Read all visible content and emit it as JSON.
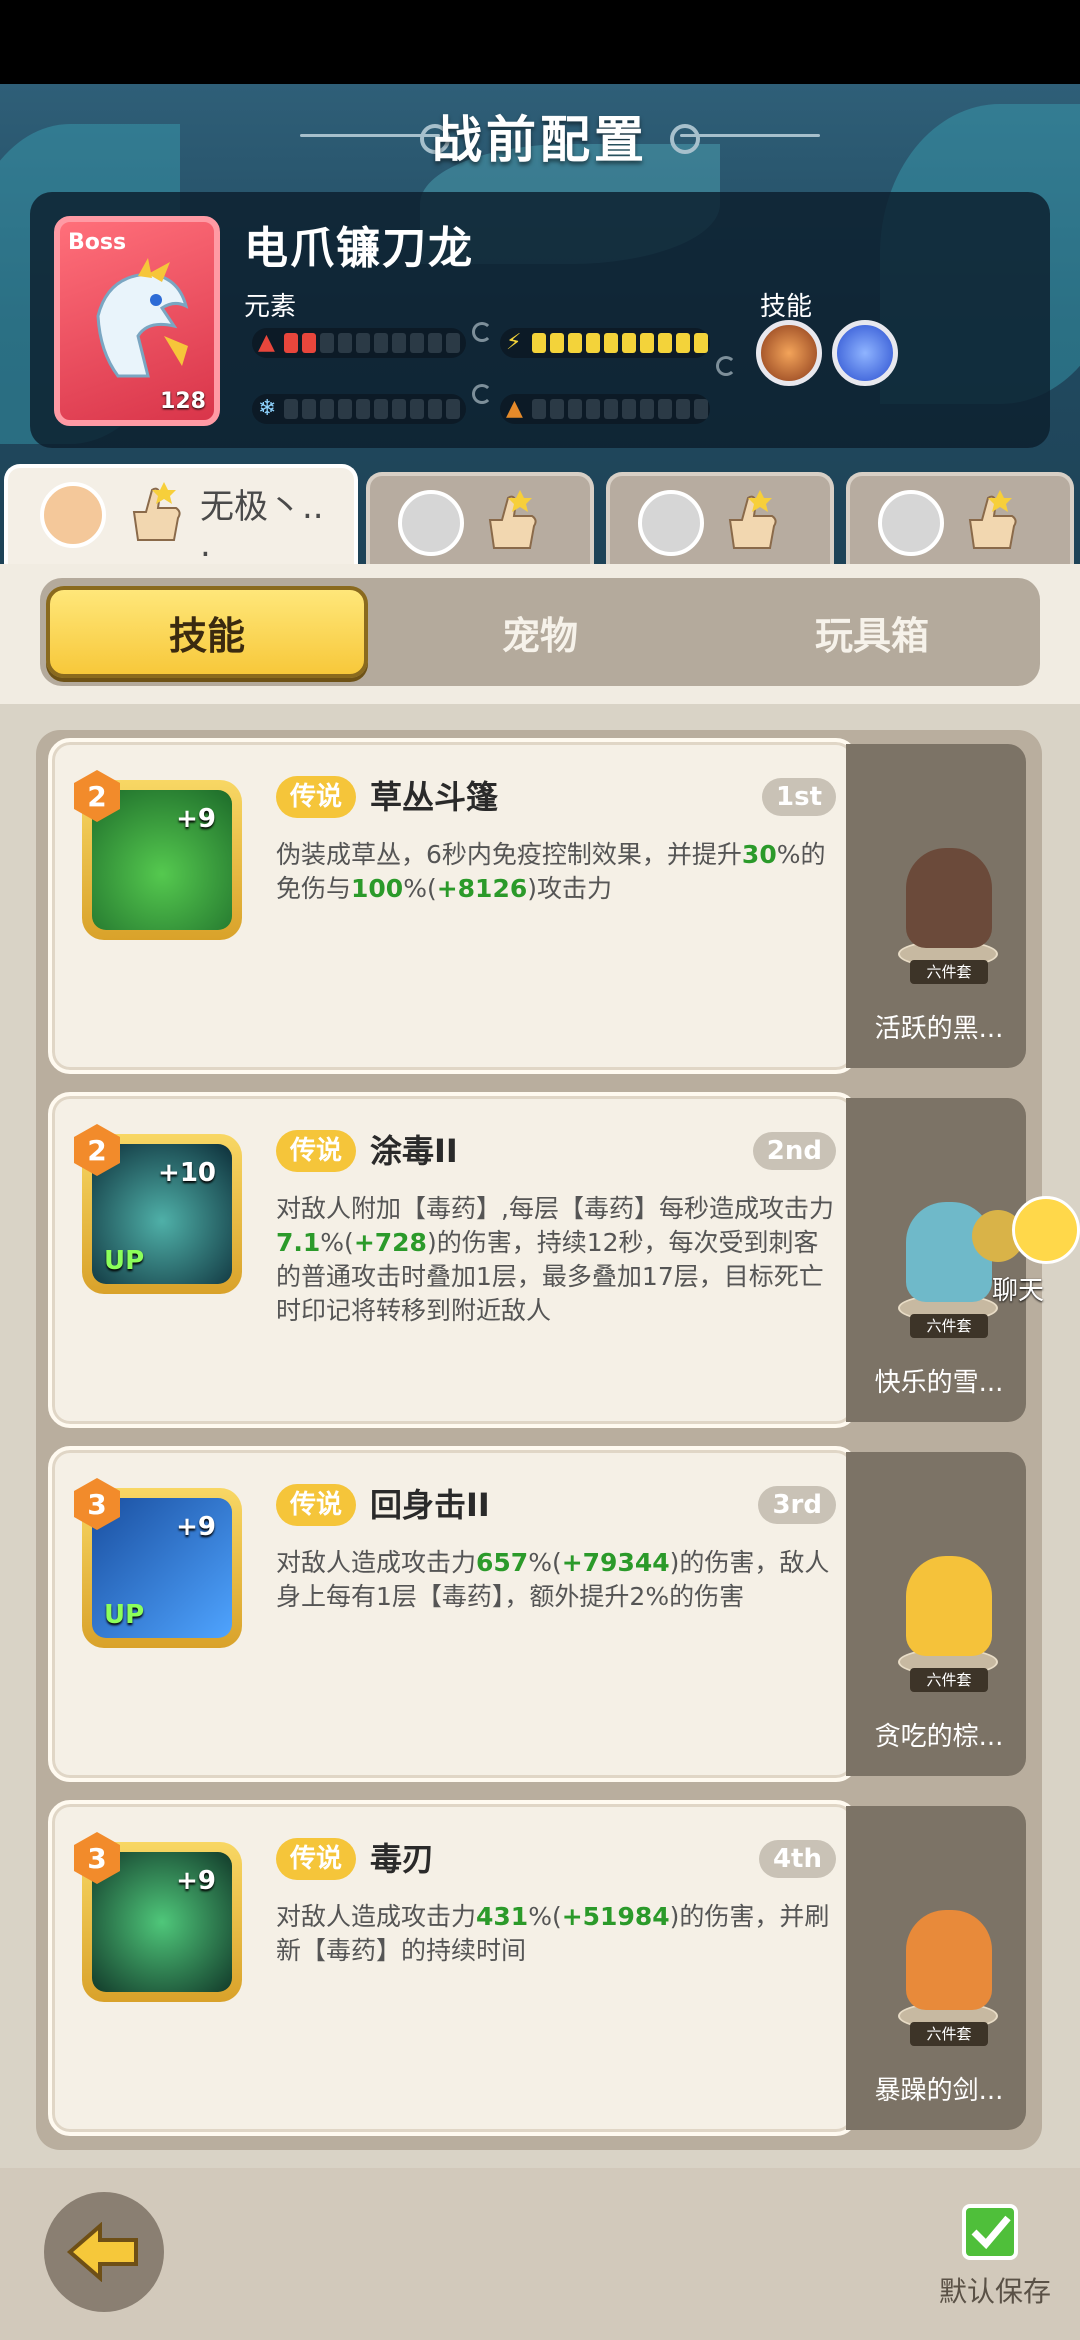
{
  "header": {
    "title": "战前配置"
  },
  "boss": {
    "tag": "Boss",
    "name": "电爪镰刀龙",
    "level": "128",
    "element_label": "元素",
    "skill_label": "技能",
    "elements": [
      {
        "icon": "fire-icon",
        "filled": 2,
        "color": "#e8463c"
      },
      {
        "icon": "lightning-icon",
        "filled": 10,
        "color": "#f3d33a"
      },
      {
        "icon": "ice-icon",
        "filled": 0,
        "color": "#8fd4ff"
      },
      {
        "icon": "earth-icon",
        "filled": 0,
        "color": "#e58a2a"
      }
    ],
    "skills": [
      "claw-skill-icon",
      "lightning-skill-icon"
    ]
  },
  "players": [
    {
      "name": "无极丶.. .",
      "active": true
    },
    {
      "name": "",
      "active": false
    },
    {
      "name": "",
      "active": false
    },
    {
      "name": "",
      "active": false
    }
  ],
  "tabs": [
    {
      "label": "技能",
      "active": true
    },
    {
      "label": "宠物",
      "active": false
    },
    {
      "label": "玩具箱",
      "active": false
    }
  ],
  "skills": [
    {
      "level": "2",
      "plus": "+9",
      "up": "",
      "rarity": "传说",
      "name": "草丛斗篷",
      "rank": "1st",
      "desc": [
        {
          "t": "伪装成草丛，6秒内免疫控制效果，并提升",
          "g": false
        },
        {
          "t": "30",
          "g": true
        },
        {
          "t": "%的免伤与",
          "g": false
        },
        {
          "t": "100",
          "g": true
        },
        {
          "t": "%(",
          "g": false
        },
        {
          "t": "+8126",
          "g": true
        },
        {
          "t": ")攻击力",
          "g": false
        }
      ],
      "pet": {
        "set": "六件套",
        "name": "活跃的黑..."
      }
    },
    {
      "level": "2",
      "plus": "+10",
      "up": "UP",
      "rarity": "传说",
      "name": "涂毒II",
      "rank": "2nd",
      "desc": [
        {
          "t": "对敌人附加【毒药】,每层【毒药】每秒造成攻击力",
          "g": false
        },
        {
          "t": "7.1",
          "g": true
        },
        {
          "t": "%(",
          "g": false
        },
        {
          "t": "+728",
          "g": true
        },
        {
          "t": ")的伤害，持续12秒，每次受到刺客的普通攻击时叠加1层，最多叠加17层，目标死亡时印记将转移到附近敌人",
          "g": false
        }
      ],
      "pet": {
        "set": "六件套",
        "name": "快乐的雪..."
      }
    },
    {
      "level": "3",
      "plus": "+9",
      "up": "UP",
      "rarity": "传说",
      "name": "回身击II",
      "rank": "3rd",
      "desc": [
        {
          "t": "对敌人造成攻击力",
          "g": false
        },
        {
          "t": "657",
          "g": true
        },
        {
          "t": "%(",
          "g": false
        },
        {
          "t": "+79344",
          "g": true
        },
        {
          "t": ")的伤害，敌人身上每有1层【毒药】，额外提升2%的伤害",
          "g": false
        }
      ],
      "pet": {
        "set": "六件套",
        "name": "贪吃的棕..."
      }
    },
    {
      "level": "3",
      "plus": "+9",
      "up": "",
      "rarity": "传说",
      "name": "毒刃",
      "rank": "4th",
      "desc": [
        {
          "t": "对敌人造成攻击力",
          "g": false
        },
        {
          "t": "431",
          "g": true
        },
        {
          "t": "%(",
          "g": false
        },
        {
          "t": "+51984",
          "g": true
        },
        {
          "t": ")的伤害，并刷新【毒药】的持续时间",
          "g": false
        }
      ],
      "pet": {
        "set": "六件套",
        "name": "暴躁的剑..."
      }
    }
  ],
  "chat": {
    "label": "聊天"
  },
  "footer": {
    "save_label": "默认保存"
  }
}
